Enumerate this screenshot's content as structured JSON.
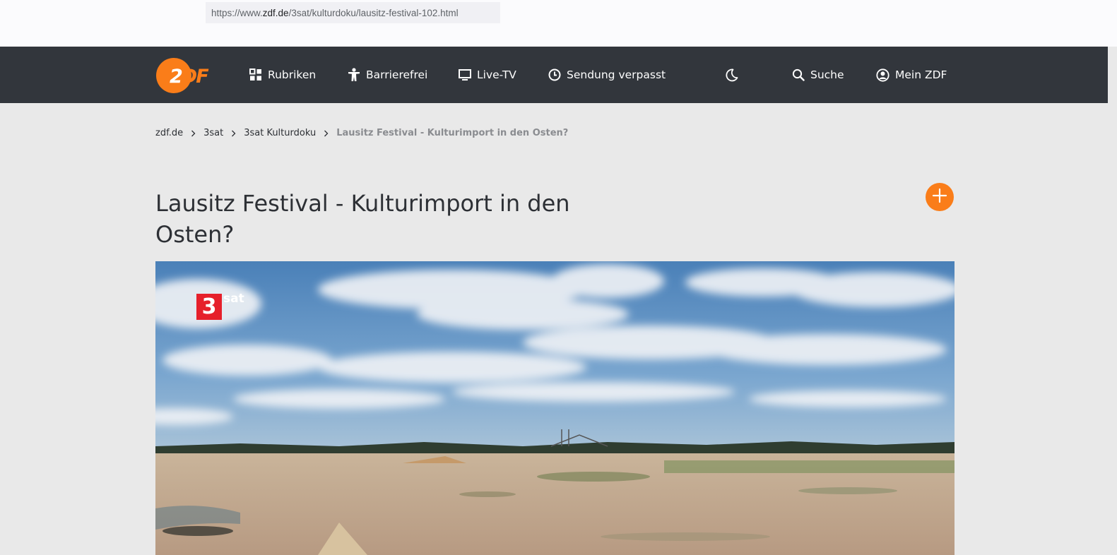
{
  "browser": {
    "url_prefix": "https://www.",
    "url_host": "zdf.de",
    "url_path": "/3sat/kulturdoku/lausitz-festival-102.html"
  },
  "header": {
    "logo_text": "2DF",
    "brand_color": "#fa7d19",
    "nav_background": "#32363c",
    "nav_items": [
      {
        "label": "Rubriken",
        "icon": "grid-icon"
      },
      {
        "label": "Barrierefrei",
        "icon": "accessibility-icon"
      },
      {
        "label": "Live-TV",
        "icon": "tv-icon"
      },
      {
        "label": "Sendung verpasst",
        "icon": "clock-icon"
      }
    ],
    "dark_mode_icon": "moon-icon",
    "search_label": "Suche",
    "account_label": "Mein ZDF"
  },
  "breadcrumb": [
    {
      "label": "zdf.de"
    },
    {
      "label": "3sat"
    },
    {
      "label": "3sat Kulturdoku"
    },
    {
      "label": "Lausitz Festival - Kulturimport in den Osten?"
    }
  ],
  "page": {
    "title": "Lausitz Festival - Kulturimport in den Osten?",
    "add_icon": "plus-icon"
  },
  "video": {
    "channel_logo_digit": "3",
    "channel_logo_text": "sat",
    "channel_color": "#e6202b"
  }
}
